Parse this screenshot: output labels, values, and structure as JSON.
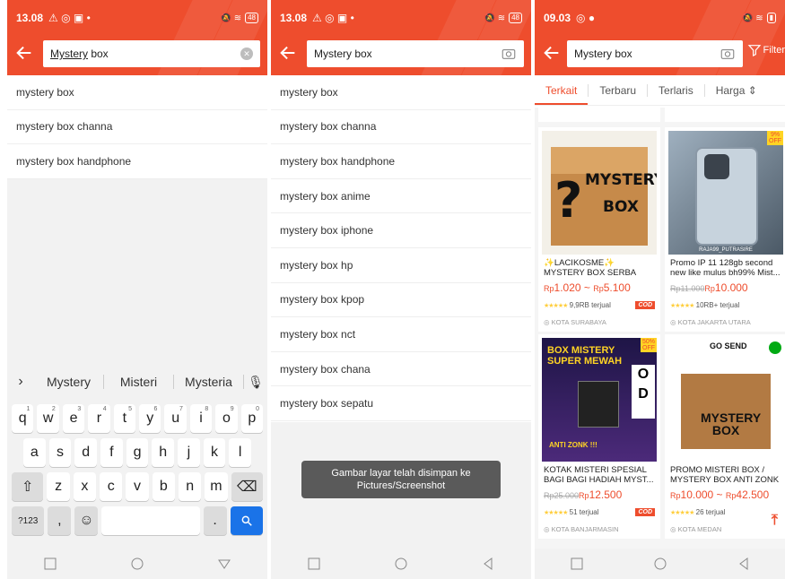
{
  "panel1": {
    "status": {
      "time": "13.08",
      "battery": "48"
    },
    "search": {
      "value_underlined": "Mystery",
      "value_rest": " box"
    },
    "suggestions": [
      "mystery box",
      "mystery box channa",
      "mystery box handphone"
    ],
    "keyboard": {
      "predictions": [
        "Mystery",
        "Misteri",
        "Mysteria"
      ],
      "row1": [
        [
          "q",
          "1"
        ],
        [
          "w",
          "2"
        ],
        [
          "e",
          "3"
        ],
        [
          "r",
          "4"
        ],
        [
          "t",
          "5"
        ],
        [
          "y",
          "6"
        ],
        [
          "u",
          "7"
        ],
        [
          "i",
          "8"
        ],
        [
          "o",
          "9"
        ],
        [
          "p",
          "0"
        ]
      ],
      "row2": [
        "a",
        "s",
        "d",
        "f",
        "g",
        "h",
        "j",
        "k",
        "l"
      ],
      "row3": [
        "z",
        "x",
        "c",
        "v",
        "b",
        "n",
        "m"
      ],
      "symbols_key": "?123",
      "comma_key": ",",
      "period_key": "."
    }
  },
  "panel2": {
    "status": {
      "time": "13.08",
      "battery": "48"
    },
    "search": {
      "value": "Mystery box"
    },
    "suggestions": [
      "mystery box",
      "mystery box channa",
      "mystery box handphone",
      "mystery box anime",
      "mystery box iphone",
      "mystery box hp",
      "mystery box kpop",
      "mystery box nct",
      "mystery box chana",
      "mystery box sepatu"
    ],
    "toast_line1": "Gambar layar telah disimpan ke",
    "toast_line2": "Pictures/Screenshot"
  },
  "panel3": {
    "status": {
      "time": "09.03"
    },
    "search": {
      "value": "Mystery box"
    },
    "filter_label": "Filter",
    "tabs": [
      "Terkait",
      "Terbaru",
      "Terlaris",
      "Harga"
    ],
    "products": [
      {
        "title": "✨LACIKOSME✨ MYSTERY BOX SERBA SERIBU - BAR...",
        "old_price": "",
        "price_from": "1.020",
        "price_to": "5.100",
        "sold": "9,9RB terjual",
        "cod": "COD",
        "location": "KOTA SURABAYA",
        "discount": "",
        "image_text": "MYSTERY BOX"
      },
      {
        "title": "Promo IP 11 128gb second new like mulus bh99% Mist...",
        "old_price": "Rp11.000",
        "price_from": "10.000",
        "price_to": "",
        "sold": "10RB+ terjual",
        "cod": "",
        "location": "KOTA JAKARTA UTARA",
        "discount": "9% OFF",
        "image_text": "RAJA99_PUTRASIRE"
      },
      {
        "title": "KOTAK MISTERI SPESIAL BAGI BAGI HADIAH MYST...",
        "old_price": "Rp25.000",
        "price_from": "12.500",
        "price_to": "",
        "sold": "51 terjual",
        "cod": "COD",
        "location": "KOTA BANJARMASIN",
        "discount": "50% OFF",
        "image_text": "BOX MISTERY SUPER MEWAH"
      },
      {
        "title": "PROMO MISTERI BOX / MYSTERY BOX ANTI ZONK",
        "old_price": "",
        "price_from": "10.000",
        "price_to": "42.500",
        "sold": "26 terjual",
        "cod": "",
        "location": "KOTA MEDAN",
        "discount": "",
        "image_text": "GO SEND"
      }
    ],
    "currency": "Rp",
    "price_sep": " ~ "
  },
  "colors": {
    "accent": "#ee4d2d",
    "keyboard_blue": "#1a73e8"
  }
}
